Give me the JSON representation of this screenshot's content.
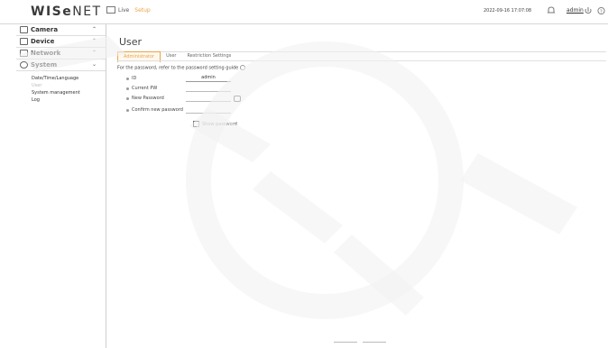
{
  "app": {
    "logo_bold": "WISe",
    "logo_rest": "NET",
    "live_label": "Live",
    "setup_label": "Setup",
    "datetime": "2022-09-16 17:07:08",
    "user": "admin"
  },
  "sidebar": {
    "items": [
      {
        "label": "Camera",
        "icon": "camera-icon"
      },
      {
        "label": "Device",
        "icon": "device-icon"
      },
      {
        "label": "Network",
        "icon": "network-icon"
      },
      {
        "label": "System",
        "icon": "system-icon"
      }
    ],
    "system_sub": [
      {
        "label": "Date/Time/Language"
      },
      {
        "label": "User"
      },
      {
        "label": "System management"
      },
      {
        "label": "Log"
      }
    ]
  },
  "main": {
    "title": "User",
    "tabs": [
      "Administrator",
      "User",
      "Restriction Settings"
    ],
    "hint": "For the password, refer to the password setting guide",
    "fields": {
      "id_label": "ID",
      "id_value": "admin",
      "current_pw_label": "Current PW",
      "new_pw_label": "New Password",
      "confirm_pw_label": "Confirm new password",
      "show_password": "Show password"
    }
  }
}
